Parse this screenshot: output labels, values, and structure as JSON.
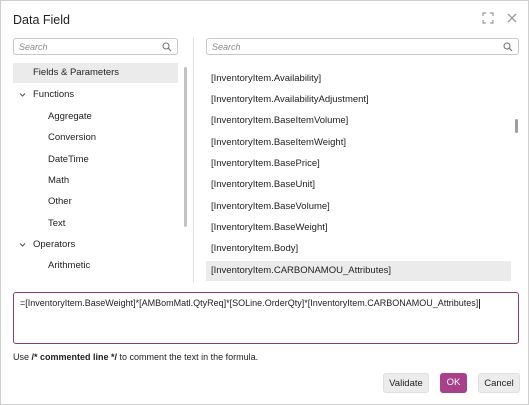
{
  "dialog": {
    "title": "Data Field",
    "window_icons": [
      "maximize-icon",
      "close-icon"
    ]
  },
  "left_search": {
    "placeholder": "Search",
    "icon": "search-icon"
  },
  "right_search": {
    "placeholder": "Search",
    "icon": "search-icon"
  },
  "tree": [
    {
      "label": "Fields & Parameters",
      "level": 0,
      "expander": "",
      "selected": true
    },
    {
      "label": "Functions",
      "level": 0,
      "expander": "chevron-down-icon",
      "selected": false
    },
    {
      "label": "Aggregate",
      "level": 1,
      "expander": "",
      "selected": false
    },
    {
      "label": "Conversion",
      "level": 1,
      "expander": "",
      "selected": false
    },
    {
      "label": "DateTime",
      "level": 1,
      "expander": "",
      "selected": false
    },
    {
      "label": "Math",
      "level": 1,
      "expander": "",
      "selected": false
    },
    {
      "label": "Other",
      "level": 1,
      "expander": "",
      "selected": false
    },
    {
      "label": "Text",
      "level": 1,
      "expander": "",
      "selected": false
    },
    {
      "label": "Operators",
      "level": 0,
      "expander": "chevron-down-icon",
      "selected": false
    },
    {
      "label": "Arithmetic",
      "level": 1,
      "expander": "",
      "selected": false
    }
  ],
  "fields": [
    {
      "label": "[InventoryItem.Availability]",
      "selected": false
    },
    {
      "label": "[InventoryItem.AvailabilityAdjustment]",
      "selected": false
    },
    {
      "label": "[InventoryItem.BaseItemVolume]",
      "selected": false
    },
    {
      "label": "[InventoryItem.BaseItemWeight]",
      "selected": false
    },
    {
      "label": "[InventoryItem.BasePrice]",
      "selected": false
    },
    {
      "label": "[InventoryItem.BaseUnit]",
      "selected": false
    },
    {
      "label": "[InventoryItem.BaseVolume]",
      "selected": false
    },
    {
      "label": "[InventoryItem.BaseWeight]",
      "selected": false
    },
    {
      "label": "[InventoryItem.Body]",
      "selected": false
    },
    {
      "label": "[InventoryItem.CARBONAMOU_Attributes]",
      "selected": true
    }
  ],
  "formula": {
    "value": "=[InventoryItem.BaseWeight]*[AMBomMatl.QtyReq]*[SOLine.OrderQty]*[InventoryItem.CARBONAMOU_Attributes]"
  },
  "hint": {
    "prefix": "Use ",
    "bold": "/* commented line */",
    "suffix": " to comment the text in the formula."
  },
  "buttons": {
    "validate": "Validate",
    "ok": "OK",
    "cancel": "Cancel"
  },
  "colors": {
    "accent": "#a8418a",
    "formula_border": "#8e3a72",
    "selection": "#ebebeb"
  }
}
